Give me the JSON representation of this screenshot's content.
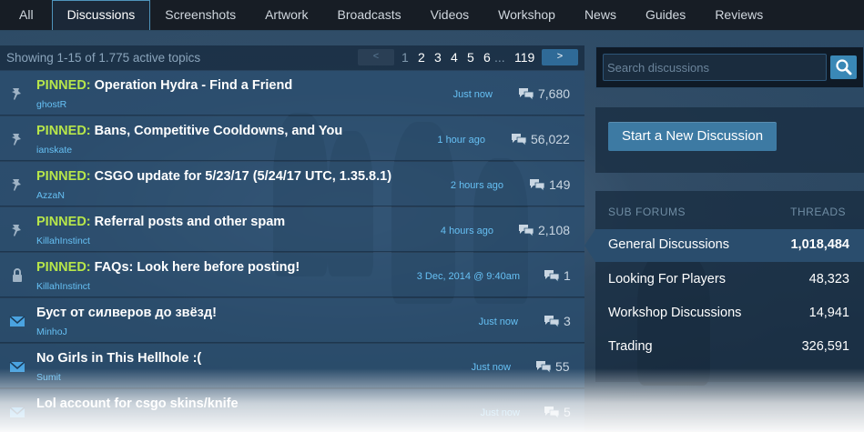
{
  "tabs": [
    {
      "label": "All"
    },
    {
      "label": "Discussions",
      "active": true
    },
    {
      "label": "Screenshots"
    },
    {
      "label": "Artwork"
    },
    {
      "label": "Broadcasts"
    },
    {
      "label": "Videos"
    },
    {
      "label": "Workshop"
    },
    {
      "label": "News"
    },
    {
      "label": "Guides"
    },
    {
      "label": "Reviews"
    }
  ],
  "topics_header": {
    "showing": "Showing 1-15 of 1.775 active topics",
    "prev_label": "<",
    "next_label": ">",
    "pages": [
      "1",
      "2",
      "3",
      "4",
      "5",
      "6",
      "...",
      "119"
    ]
  },
  "topics": [
    {
      "pinned_label": "PINNED:",
      "title": "Operation Hydra - Find a Friend",
      "author": "ghostR",
      "time": "Just now",
      "count": "7,680",
      "icon": "pin-icon"
    },
    {
      "pinned_label": "PINNED:",
      "title": "Bans, Competitive Cooldowns, and You",
      "author": "ianskate",
      "time": "1 hour ago",
      "count": "56,022",
      "icon": "pin-icon"
    },
    {
      "pinned_label": "PINNED:",
      "title": "CSGO update for 5/23/17 (5/24/17 UTC, 1.35.8.1)",
      "author": "AzzaN",
      "time": "2 hours ago",
      "count": "149",
      "icon": "pin-icon"
    },
    {
      "pinned_label": "PINNED:",
      "title": "Referral posts and other spam",
      "author": "KillahInstinct",
      "time": "4 hours ago",
      "count": "2,108",
      "icon": "pin-icon"
    },
    {
      "pinned_label": "PINNED:",
      "title": "FAQs: Look here before posting!",
      "author": "KillahInstinct",
      "time": "3 Dec, 2014 @ 9:40am",
      "count": "1",
      "icon": "lock-icon"
    },
    {
      "pinned_label": "",
      "title": "Буст от силверов до звёзд!",
      "author": "MinhoJ",
      "time": "Just now",
      "count": "3",
      "icon": "envelope-icon"
    },
    {
      "pinned_label": "",
      "title": "No Girls in This Hellhole :(",
      "author": "Sumit",
      "time": "Just now",
      "count": "55",
      "icon": "envelope-icon"
    },
    {
      "pinned_label": "",
      "title": "Lol account for csgo skins/knife",
      "author": "",
      "time": "Just now",
      "count": "5",
      "icon": "envelope-icon"
    }
  ],
  "search": {
    "placeholder": "Search discussions"
  },
  "new_discussion_label": "Start a New Discussion",
  "subforums": {
    "header_left": "SUB FORUMS",
    "header_right": "THREADS",
    "items": [
      {
        "name": "General Discussions",
        "threads": "1,018,484",
        "active": true
      },
      {
        "name": "Looking For Players",
        "threads": "48,323"
      },
      {
        "name": "Workshop Discussions",
        "threads": "14,941"
      },
      {
        "name": "Trading",
        "threads": "326,591"
      }
    ]
  },
  "colors": {
    "pinned": "#b7e64a",
    "link": "#66c0f4",
    "accent_button": "#3d7aa3"
  }
}
